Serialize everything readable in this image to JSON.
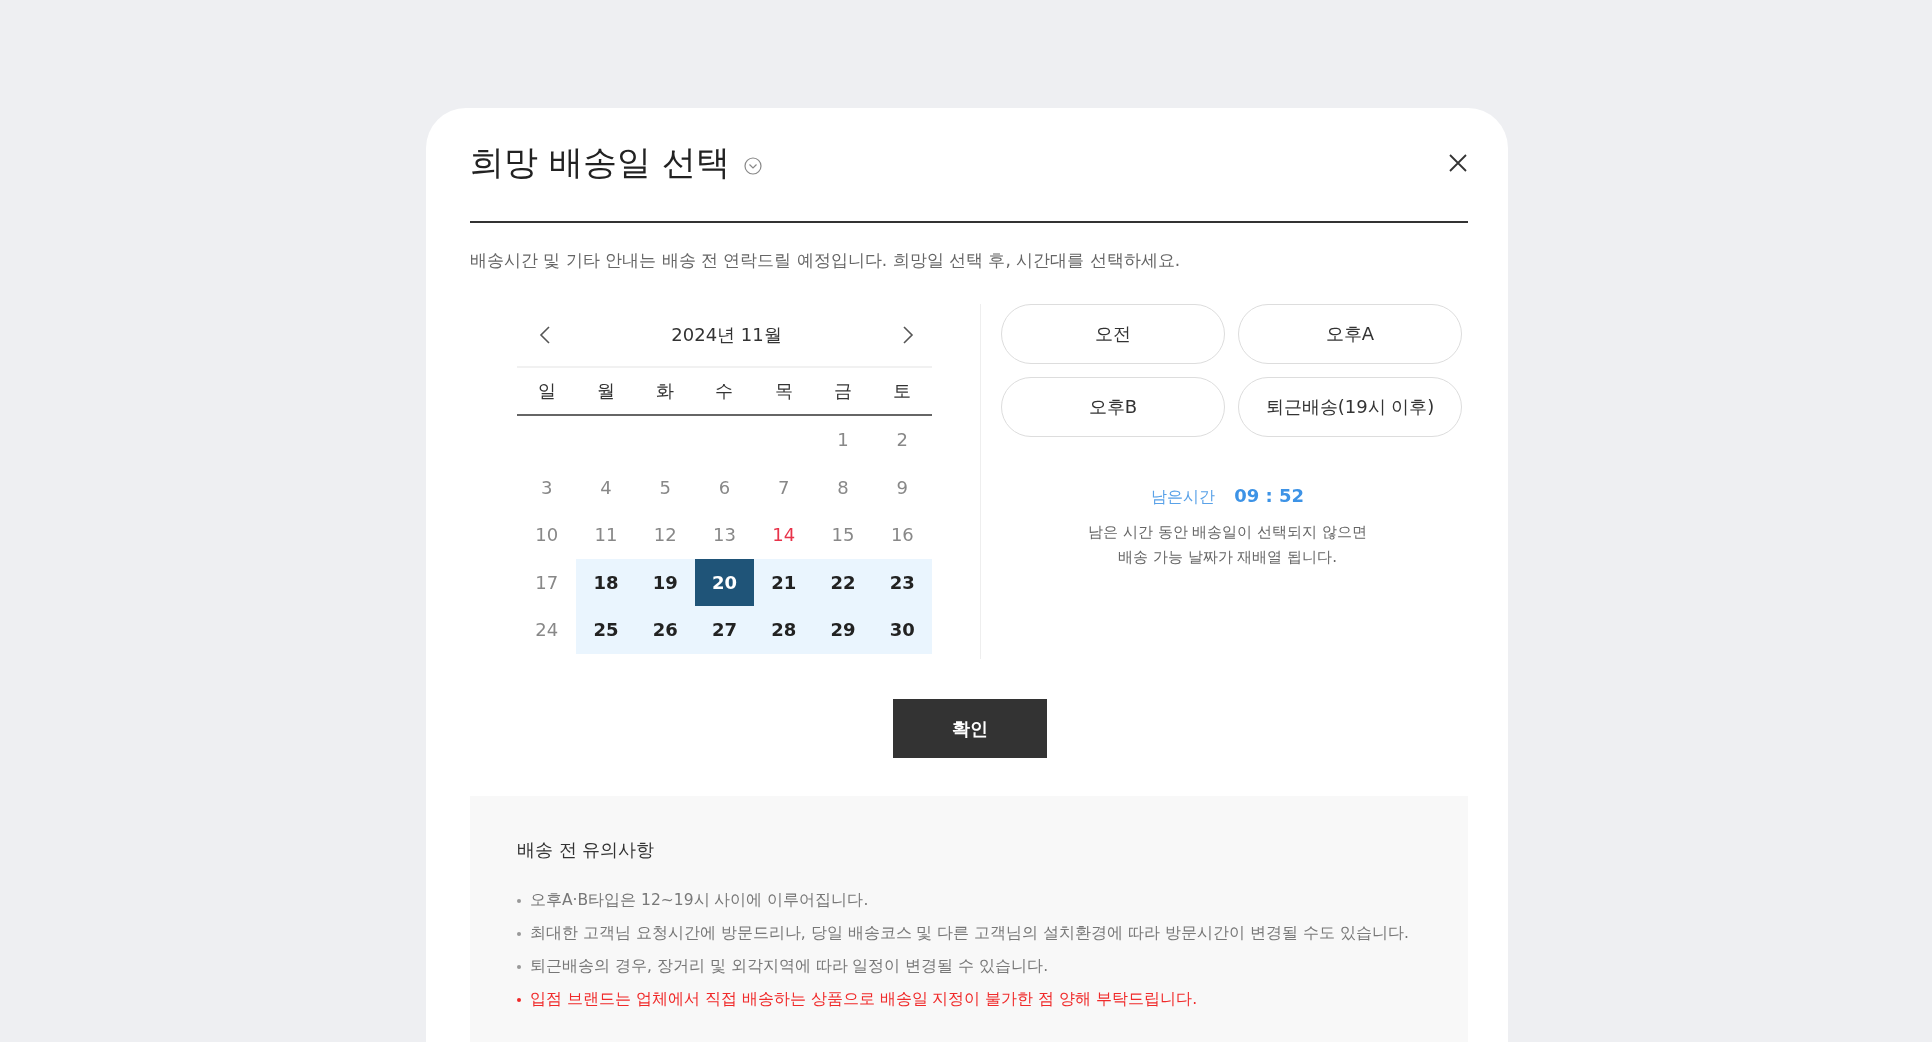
{
  "dialog": {
    "title": "희망 배송일 선택",
    "description": "배송시간 및 기타 안내는 배송 전 연락드릴 예정입니다. 희망일 선택 후, 시간대를 선택하세요."
  },
  "calendar": {
    "month": "2024년 11월",
    "weekdays": [
      "일",
      "월",
      "화",
      "수",
      "목",
      "금",
      "토"
    ],
    "weeks": [
      [
        {
          "label": "1",
          "kind": "disabled",
          "selected": false
        },
        {
          "label": "2",
          "kind": "disabled",
          "selected": false
        }
      ],
      [
        {
          "label": "3",
          "kind": "disabled",
          "selected": false
        },
        {
          "label": "4",
          "kind": "disabled",
          "selected": false
        },
        {
          "label": "5",
          "kind": "disabled",
          "selected": false
        },
        {
          "label": "6",
          "kind": "disabled",
          "selected": false
        },
        {
          "label": "7",
          "kind": "disabled",
          "selected": false
        },
        {
          "label": "8",
          "kind": "disabled",
          "selected": false
        },
        {
          "label": "9",
          "kind": "disabled",
          "selected": false
        }
      ],
      [
        {
          "label": "10",
          "kind": "disabled",
          "selected": false
        },
        {
          "label": "11",
          "kind": "disabled",
          "selected": false
        },
        {
          "label": "12",
          "kind": "disabled",
          "selected": false
        },
        {
          "label": "13",
          "kind": "disabled",
          "selected": false
        },
        {
          "label": "14",
          "kind": "holiday",
          "selected": false
        },
        {
          "label": "15",
          "kind": "disabled",
          "selected": false
        },
        {
          "label": "16",
          "kind": "disabled",
          "selected": false
        }
      ],
      [
        {
          "label": "17",
          "kind": "disabled",
          "selected": false
        },
        {
          "label": "18",
          "kind": "available",
          "selected": false
        },
        {
          "label": "19",
          "kind": "available",
          "selected": false
        },
        {
          "label": "20",
          "kind": "available",
          "selected": true
        },
        {
          "label": "21",
          "kind": "available",
          "selected": false
        },
        {
          "label": "22",
          "kind": "available",
          "selected": false
        },
        {
          "label": "23",
          "kind": "available",
          "selected": false
        }
      ],
      [
        {
          "label": "24",
          "kind": "disabled",
          "selected": false
        },
        {
          "label": "25",
          "kind": "available",
          "selected": false
        },
        {
          "label": "26",
          "kind": "available",
          "selected": false
        },
        {
          "label": "27",
          "kind": "available",
          "selected": false
        },
        {
          "label": "28",
          "kind": "available",
          "selected": false
        },
        {
          "label": "29",
          "kind": "available",
          "selected": false
        },
        {
          "label": "30",
          "kind": "available",
          "selected": false
        }
      ]
    ]
  },
  "time_slots": [
    {
      "label": "오전",
      "selected": false
    },
    {
      "label": "오후A",
      "selected": false
    },
    {
      "label": "오후B",
      "selected": false
    },
    {
      "label": "퇴근배송(19시 이후)",
      "selected": false
    }
  ],
  "timer": {
    "label": "남은시간",
    "value": "09 : 52",
    "message": [
      "남은 시간 동안 배송일이 선택되지 않으면",
      "배송 가능 날짜가 재배열 됩니다."
    ]
  },
  "confirm_button": "확인",
  "notice": {
    "title": "배송 전 유의사항",
    "items": [
      {
        "text": "오후A·B타입은 12~19시 사이에 이루어집니다.",
        "kind": "normal"
      },
      {
        "text": "최대한 고객님 요청시간에 방문드리나, 당일 배송코스 및 다른 고객님의 설치환경에 따라 방문시간이 변경될 수도 있습니다.",
        "kind": "normal"
      },
      {
        "text": "퇴근배송의 경우, 장거리 및 외각지역에 따라 일정이 변경될 수 있습니다.",
        "kind": "normal"
      },
      {
        "text": "입점 브랜드는 업체에서 직접 배송하는 상품으로 배송일 지정이 불가한 점 양해 부탁드립니다.",
        "kind": "warning"
      }
    ]
  }
}
